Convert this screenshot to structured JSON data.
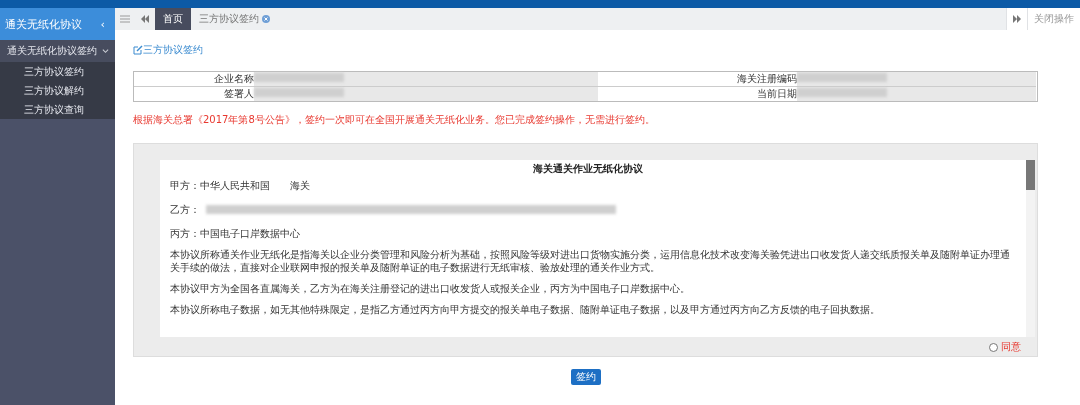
{
  "sidebar": {
    "title": "通关无纸化协议",
    "collapse_icon": "‹",
    "group": {
      "label": "通关无纸化协议签约",
      "expanded": true,
      "items": [
        {
          "label": "三方协议签约",
          "selected": false
        },
        {
          "label": "三方协议解约",
          "selected": false
        },
        {
          "label": "三方协议查询",
          "selected": false
        }
      ]
    }
  },
  "tabs": [
    {
      "label": "首页",
      "selected": true,
      "closable": false
    },
    {
      "label": "三方协议签约",
      "selected": false,
      "closable": true
    }
  ],
  "close_ops": "关闭操作",
  "page_title": "三方协议签约",
  "info": [
    {
      "label": "企业名称",
      "label2": "海关注册编码"
    },
    {
      "label": "签署人",
      "label2": "当前日期"
    }
  ],
  "notice": "根据海关总署《2017年第8号公告》，签约一次即可在全国开展通关无纸化业务。您已完成签约操作，无需进行签约。",
  "document": {
    "title": "海关通关作业无纸化协议",
    "paragraphs": [
      "甲方：中华人民共和国　　海关",
      "乙方：",
      "丙方：中国电子口岸数据中心",
      "本协议所称通关作业无纸化是指海关以企业分类管理和风险分析为基础，按照风险等级对进出口货物实施分类，运用信息化技术改变海关验凭进出口收发货人递交纸质报关单及随附单证办理通关手续的做法，直接对企业联网申报的报关单及随附单证的电子数据进行无纸审核、验放处理的通关作业方式。",
      "本协议甲方为全国各直属海关，乙方为在海关注册登记的进出口收发货人或报关企业，丙方为中国电子口岸数据中心。",
      "本协议所称电子数据，如无其他特殊限定，是指乙方通过丙方向甲方提交的报关单电子数据、随附单证电子数据，以及甲方通过丙方向乙方反馈的电子回执数据。"
    ]
  },
  "agree": {
    "label": "同意",
    "checked": false
  },
  "sign_button": "签约"
}
